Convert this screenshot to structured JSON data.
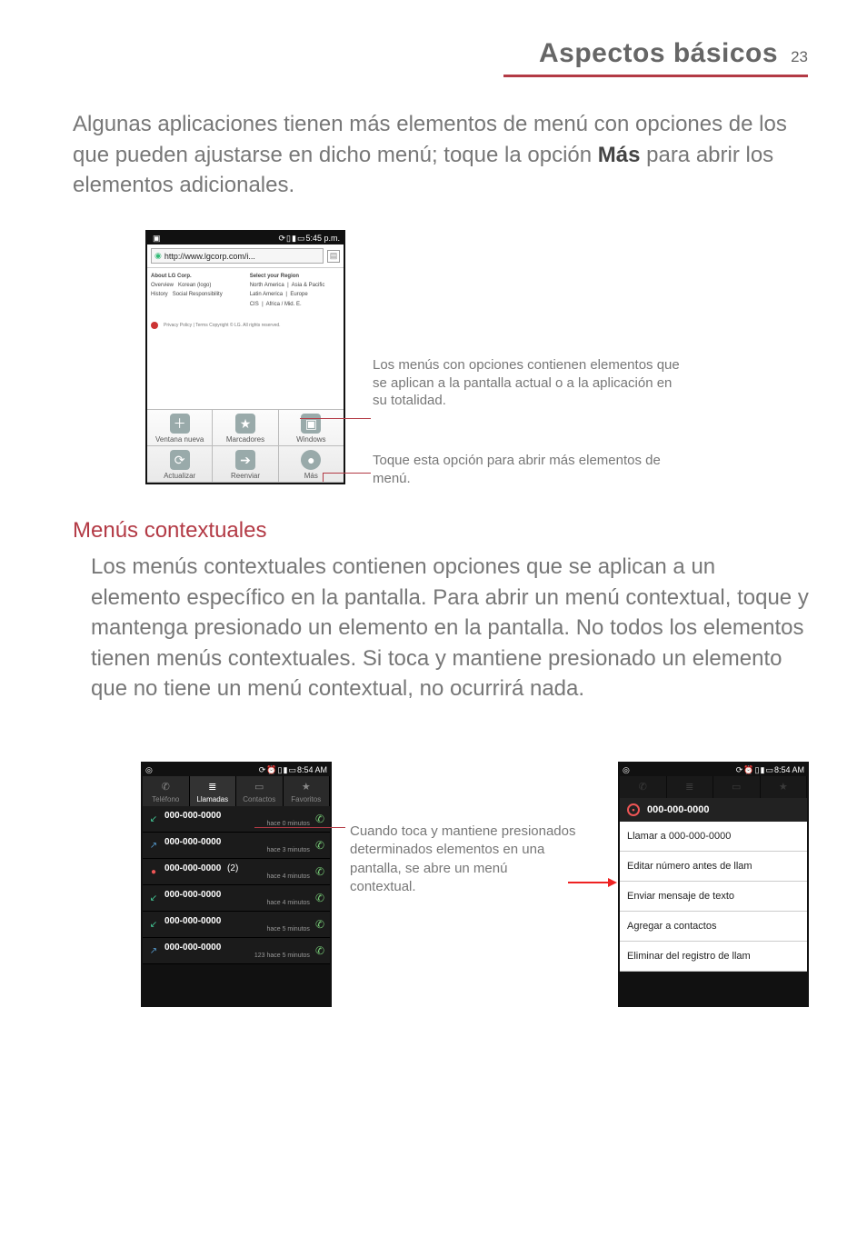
{
  "header": {
    "title": "Aspectos básicos",
    "page": "23"
  },
  "para1_a": "Algunas aplicaciones tienen más elementos de menú con opciones de los que pueden ajustarse en dicho menú; toque la opción ",
  "para1_bold": "Más",
  "para1_b": " para abrir los elementos adicionales.",
  "phone1": {
    "time": "5:45 p.m.",
    "url": "http://www.lgcorp.com/i...",
    "web": {
      "left_h": "About LG Corp.",
      "right_h": "Select your Region",
      "l1": "Overview",
      "l2": "Korean (logo)",
      "l3": "History",
      "l4": "Social Responsibility",
      "r1": "North America",
      "r2": "Asia & Pacific",
      "r3": "Latin America",
      "r4": "Europe",
      "r5": "CIS",
      "r6": "Africa / Mid. E.",
      "foot": "Privacy Policy | Terms  Copyright © LG. All rights reserved."
    },
    "opt": {
      "new": "Ventana nueva",
      "book": "Marcadores",
      "win": "Windows",
      "ref": "Actualizar",
      "fwd": "Reenviar",
      "more": "Más"
    }
  },
  "callout1": "Los menús con opciones contienen elementos que se aplican a la pantalla actual o a la aplicación en su totalidad.",
  "callout2": "Toque esta opción para abrir más elementos de menú.",
  "h2": "Menús contextuales",
  "para2": "Los menús contextuales contienen opciones que se aplican a un elemento específico en la pantalla. Para abrir un menú contextual, toque y mantenga presionado un elemento en la pantalla. No todos los elementos tienen menús contextuales. Si toca y mantiene presionado un elemento que no tiene un menú contextual, no ocurrirá nada.",
  "pbTime": "8:54 AM",
  "tabs": {
    "t1": "Teléfono",
    "t2": "Llamadas",
    "t3": "Contactos",
    "t4": "Favoritos"
  },
  "calls": [
    {
      "dir": "in",
      "num": "000-000-0000",
      "sub": "hace 0 minutos",
      "cnt": ""
    },
    {
      "dir": "out",
      "num": "000-000-0000",
      "sub": "hace 3 minutos",
      "cnt": ""
    },
    {
      "dir": "miss",
      "num": "000-000-0000",
      "sub": "hace 4 minutos",
      "cnt": "(2)"
    },
    {
      "dir": "in",
      "num": "000-000-0000",
      "sub": "hace 4 minutos",
      "cnt": ""
    },
    {
      "dir": "in",
      "num": "000-000-0000",
      "sub": "hace 5 minutos",
      "cnt": ""
    },
    {
      "dir": "out",
      "num": "000-000-0000",
      "sub": "hace 5 minutos",
      "cnt": ""
    }
  ],
  "callSubExtra": "123",
  "ctx": {
    "title": "000-000-0000",
    "items": [
      "Llamar a 000-000-0000",
      "Editar número antes de llam",
      "Enviar mensaje de texto",
      "Agregar a contactos",
      "Eliminar del registro de llam"
    ]
  },
  "callout3": "Cuando toca y mantiene presionados determinados elementos en una pantalla, se abre un menú contextual."
}
